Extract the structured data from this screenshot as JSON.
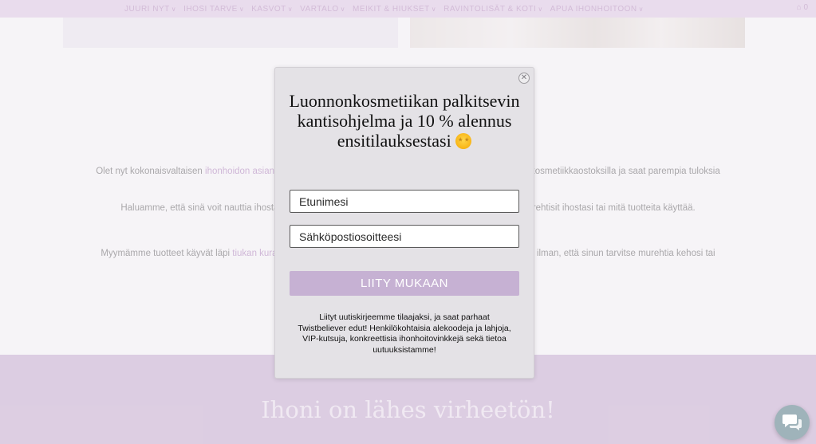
{
  "nav": {
    "items": [
      {
        "label": "JUURI NYT",
        "chevron": true
      },
      {
        "label": "IHOSI TARVE",
        "chevron": true
      },
      {
        "label": "KASVOT",
        "chevron": true
      },
      {
        "label": "VARTALO",
        "chevron": true
      },
      {
        "label": "MEIKIT & HIUKSET",
        "chevron": true
      },
      {
        "label": "RAVINTOLISÄT & KOTI",
        "chevron": true
      },
      {
        "label": "APUA IHONHOITOON",
        "chevron": true
      }
    ],
    "cart_count": "0"
  },
  "content": {
    "p1": {
      "pre": "Olet nyt kokonaisvaltaisen ",
      "link": "ihonhoidon asiantun",
      "post": "kosmetiikkaostoksilla ja saat parempia tuloksia"
    },
    "p2": {
      "pre": "Haluamme, että sinä voit nauttia ihostasi",
      "post": "rehtisit ihostasi tai mitä tuotteita käyttää."
    },
    "p3": {
      "pre": "Myymämme tuotteet käyvät läpi ",
      "link": "tiukan kurato",
      "post": "i ilman, että sinun tarvitse murehtia kehosi tai"
    }
  },
  "banner": {
    "title": "Ihoni on lähes virheetön!"
  },
  "popup": {
    "close_symbol": "✕",
    "title": "Luonnonkosmetiikan palkitsevin kantisohjelma ja 10 % alennus ensitilauksestasi",
    "emoji": "star-struck-emoji",
    "first_name_placeholder": "Etunimesi",
    "email_placeholder": "Sähköpostiosoitteesi",
    "submit_label": "LIITY MUKAAN",
    "disclaimer": "Liityt uutiskirjeemme tilaajaksi, ja saat parhaat Twistbeliever edut! Henkilökohtaisia alekoodeja ja lahjoja, VIP-kutsuja, konkreettisia ihonhoitovinkkejä sekä tietoa uutuuksistamme!"
  },
  "icons": {
    "cart": "cart-icon",
    "chat": "chat-icon",
    "close": "close-icon"
  },
  "colors": {
    "accent": "#c6b1d3",
    "link": "#c5a3cf",
    "banner": "#d8c4df",
    "nav_bg": "#ecdaf0"
  }
}
